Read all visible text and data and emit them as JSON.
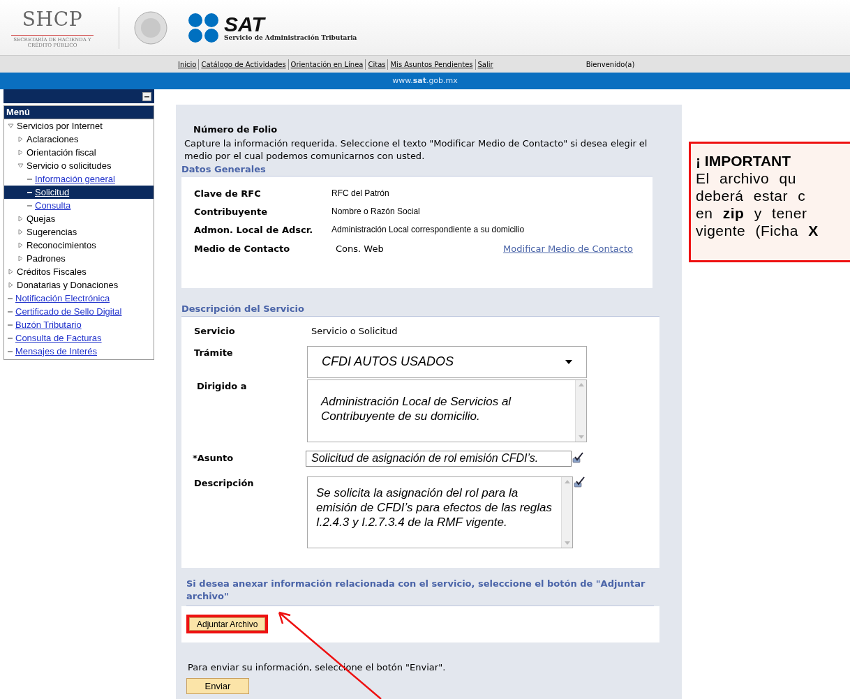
{
  "header": {
    "shcp_logo": "SHCP",
    "shcp_subtitle": "SECRETARÍA DE HACIENDA Y CRÉDITO PÚBLICO",
    "sat_logo": "SAT",
    "sat_subtitle": "Servicio de Administración Tributaria"
  },
  "nav": {
    "links": [
      "Inicio",
      "Catálogo de Actividades",
      "Orientación en Línea",
      "Citas",
      "Mis Asuntos Pendientes",
      "Salir"
    ],
    "welcome": "Bienvenido(a)"
  },
  "banner": {
    "url": "www.**sat**.gob.mx"
  },
  "sidebar": {
    "title": "Menú",
    "items": [
      {
        "label": "Servicios por Internet",
        "kind": "folder",
        "expanded": true,
        "selected": false,
        "children": [
          {
            "label": "Aclaraciones",
            "kind": "folder",
            "expanded": false,
            "selected": false
          },
          {
            "label": "Orientación fiscal",
            "kind": "folder",
            "expanded": false,
            "selected": false
          },
          {
            "label": "Servicio o solicitudes",
            "kind": "folder",
            "expanded": true,
            "selected": false,
            "children": [
              {
                "label": "Información general",
                "kind": "link",
                "selected": false
              },
              {
                "label": "Solicitud",
                "kind": "link",
                "selected": true
              },
              {
                "label": "Consulta",
                "kind": "link",
                "selected": false
              }
            ]
          },
          {
            "label": "Quejas",
            "kind": "folder",
            "expanded": false,
            "selected": false
          },
          {
            "label": "Sugerencias",
            "kind": "folder",
            "expanded": false,
            "selected": false
          },
          {
            "label": "Reconocimientos",
            "kind": "folder",
            "expanded": false,
            "selected": false
          },
          {
            "label": "Padrones",
            "kind": "folder",
            "expanded": false,
            "selected": false
          }
        ]
      },
      {
        "label": "Créditos Fiscales",
        "kind": "folder",
        "expanded": false,
        "selected": false
      },
      {
        "label": "Donatarias y Donaciones",
        "kind": "folder",
        "expanded": false,
        "selected": false
      },
      {
        "label": "Notificación Electrónica",
        "kind": "link",
        "selected": false
      },
      {
        "label": "Certificado de Sello Digital",
        "kind": "link",
        "selected": false
      },
      {
        "label": "Buzón Tributario",
        "kind": "link",
        "selected": false
      },
      {
        "label": "Consulta de Facturas",
        "kind": "link",
        "selected": false
      },
      {
        "label": "Mensajes de Interés",
        "kind": "link",
        "selected": false
      }
    ]
  },
  "form": {
    "folio_title": "Número de Folio",
    "instructions": "Capture la información requerida. Seleccione el texto \"Modificar Medio de Contacto\" si desea elegir el medio por el cual podemos comunicarnos con usted.",
    "general_title": "Datos Generales",
    "general_fields": [
      {
        "label": "Clave de RFC",
        "value": "RFC del Patrón"
      },
      {
        "label": "Contribuyente",
        "value": "Nombre o Razón Social"
      },
      {
        "label": "Admon. Local de Adscr.",
        "value": "Administración Local  correspondiente a su domicilio"
      }
    ],
    "contact": {
      "label": "Medio de Contacto",
      "value": "Cons. Web",
      "link": "Modificar Medio de Contacto"
    },
    "service_title": "Descripción del Servicio",
    "servicio": {
      "label": "Servicio",
      "value": "Servicio o Solicitud"
    },
    "tramite": {
      "label": "Trámite",
      "value": "CFDI AUTOS USADOS"
    },
    "dirigido": {
      "label": "Dirigido a",
      "value": "Administración Local de Servicios al Contribuyente de su domicilio."
    },
    "asunto": {
      "label": "*Asunto",
      "value": "Solicitud de asignación de rol emisión CFDI’s."
    },
    "descripcion": {
      "label": "Descripción",
      "value": "Se solicita la asignación del rol para la emisión de CFDI’s para efectos de las reglas I.2.4.3 y I.2.7.3.4 de la RMF vigente."
    },
    "attach_hint": "Si desea anexar información relacionada con el servicio, seleccione el botón de \"Adjuntar archivo\"",
    "attach_button": "Adjuntar Archivo",
    "send_hint": "Para enviar su información, seleccione el botón \"Enviar\".",
    "send_button": "Enviar"
  },
  "callout": {
    "title": "¡ IMPORTANT",
    "lines": [
      "El archivo qu",
      "deberá estar c",
      "en **zip** y tener",
      "vigente (Ficha **X**"
    ]
  }
}
